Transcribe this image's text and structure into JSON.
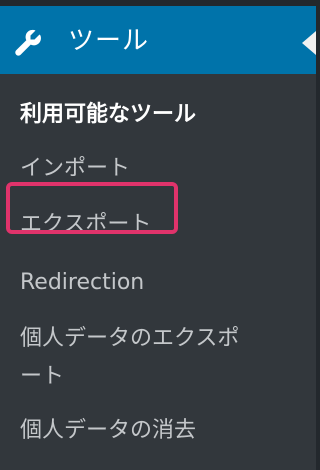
{
  "menu": {
    "icon": "wrench-icon",
    "title": "ツール"
  },
  "submenu": {
    "items": [
      {
        "label": "利用可能なツール",
        "current": true
      },
      {
        "label": "インポート",
        "current": false
      },
      {
        "label": "エクスポート",
        "current": false
      },
      {
        "label": "Redirection",
        "current": false,
        "highlighted": true
      },
      {
        "label_line1": "個人データのエクスポ",
        "label_line2": "ート",
        "current": false
      },
      {
        "label": "個人データの消去",
        "current": false
      }
    ]
  },
  "colors": {
    "menu_bg": "#0073aa",
    "submenu_bg": "#32373c",
    "highlight": "#e0336b"
  }
}
